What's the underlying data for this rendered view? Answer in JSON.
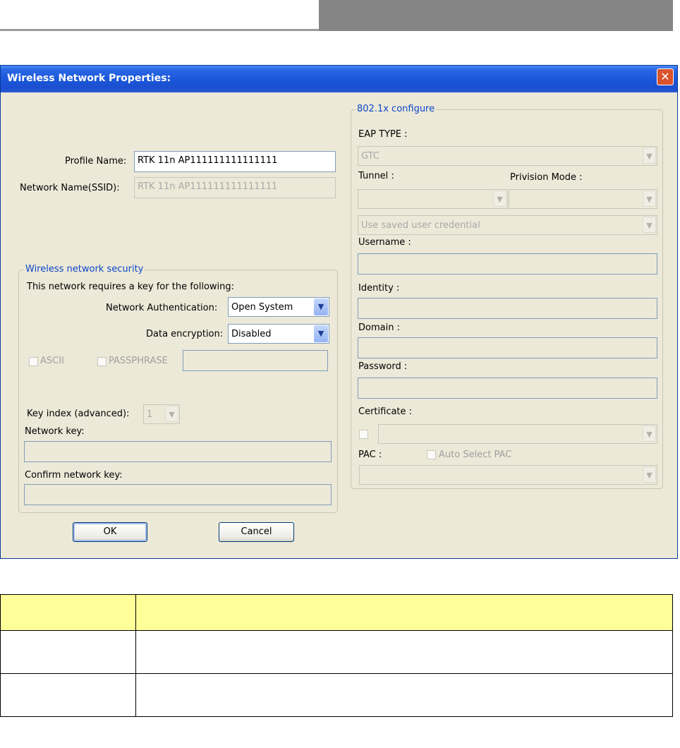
{
  "dialog": {
    "title": "Wireless Network Properties:",
    "close_glyph": "✕",
    "profile_name_label": "Profile Name:",
    "profile_name_value": "RTK 11n AP111111111111111",
    "ssid_label": "Network Name(SSID):",
    "ssid_value": "RTK 11n AP111111111111111",
    "security": {
      "legend": "Wireless network security",
      "requires_text": "This network requires a key for the following:",
      "auth_label": "Network Authentication:",
      "auth_value": "Open System",
      "enc_label": "Data encryption:",
      "enc_value": "Disabled",
      "ascii_label": "ASCII",
      "passphrase_label": "PASSPHRASE",
      "key_index_label": "Key index (advanced):",
      "key_index_value": "1",
      "network_key_label": "Network key:",
      "confirm_key_label": "Confirm network key:"
    },
    "dot1x": {
      "legend": "802.1x configure",
      "eap_type_label": "EAP TYPE :",
      "eap_type_value": "GTC",
      "tunnel_label": "Tunnel :",
      "provision_label": "Privision Mode :",
      "credential_value": "Use saved user credential",
      "username_label": "Username :",
      "identity_label": "Identity :",
      "domain_label": "Domain :",
      "password_label": "Password :",
      "certificate_label": "Certificate :",
      "pac_label": "PAC :",
      "auto_pac_label": "Auto Select PAC"
    },
    "ok_label": "OK",
    "cancel_label": "Cancel",
    "dropdown_glyph": "▼"
  },
  "colors": {
    "titlebar": "#1b56d8",
    "dialog_bg": "#ece9d8",
    "legend_text": "#0c46c6",
    "table_header": "#ffff99",
    "header_bar": "#858585"
  }
}
